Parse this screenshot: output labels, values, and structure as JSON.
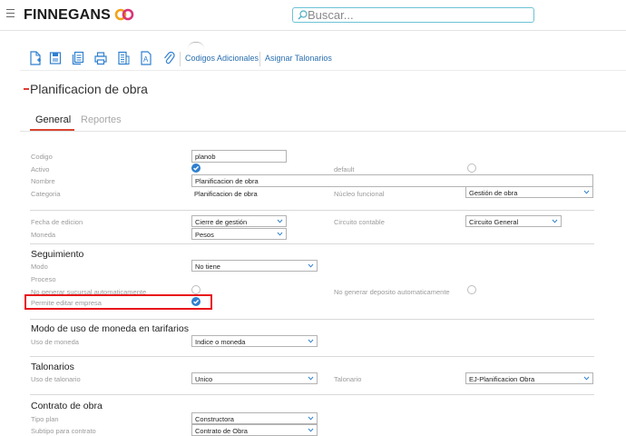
{
  "header": {
    "brand": "FINNEGANS",
    "search_placeholder": "Buscar..."
  },
  "toolbar": {
    "icons": [
      "new-document-icon",
      "save-icon",
      "copy-icon",
      "print-icon",
      "list-document-icon",
      "text-document-icon",
      "attachment-icon"
    ],
    "codigos_adicionales": "Codigos Adicionales",
    "asignar_talonarios": "Asignar Talonarios"
  },
  "page": {
    "title": "Planificacion de obra"
  },
  "tabs": [
    "General",
    "Reportes"
  ],
  "fields": {
    "codigo": {
      "label": "Codigo",
      "value": "planob"
    },
    "activo": {
      "label": "Activo",
      "checked": true
    },
    "default": {
      "label": "default",
      "checked": false
    },
    "nombre": {
      "label": "Nombre",
      "value": "Planificacion de obra"
    },
    "categoria": {
      "label": "Categoria",
      "value": "Planificacion de obra"
    },
    "nucleo_funcional": {
      "label": "Núcleo funcional",
      "value": "Gestión de obra"
    },
    "fecha_edicion": {
      "label": "Fecha de edicion",
      "value": "Cierre de gestión"
    },
    "circuito_contable": {
      "label": "Circuito contable",
      "value": "Circuito General"
    },
    "moneda": {
      "label": "Moneda",
      "value": "Pesos"
    }
  },
  "seguimiento": {
    "title": "Seguimiento",
    "modo": {
      "label": "Modo",
      "value": "No tiene"
    },
    "proceso": {
      "label": "Proceso"
    },
    "no_generar_sucursal": {
      "label": "No generar sucursal automaticamente",
      "checked": false
    },
    "no_generar_deposito": {
      "label": "No generar deposito automaticamente",
      "checked": false
    },
    "permite_editar_empresa": {
      "label": "Permite editar empresa",
      "checked": true
    }
  },
  "modo_moneda": {
    "title": "Modo de uso de moneda en tarifarios",
    "uso_moneda": {
      "label": "Uso de moneda",
      "value": "Indice o moneda"
    }
  },
  "talonarios": {
    "title": "Talonarios",
    "uso_talonario": {
      "label": "Uso de talonario",
      "value": "Unico"
    },
    "talonario": {
      "label": "Talonario",
      "value": "EJ-Planificacion Obra"
    }
  },
  "contrato": {
    "title": "Contrato de obra",
    "tipo_plan": {
      "label": "Tipo plan",
      "value": "Constructora"
    },
    "subtipo_contrato": {
      "label": "Subtipo para contrato",
      "value": "Contrato de Obra"
    }
  },
  "colors": {
    "accent": "#2f7fcf",
    "link": "#2a6fb0",
    "tab_underline": "#d8452f",
    "highlight": "#e8141b"
  }
}
